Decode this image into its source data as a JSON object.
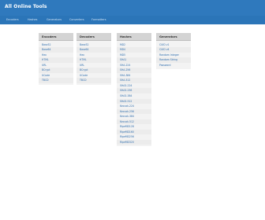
{
  "brand": "All Online Tools",
  "nav": [
    "Encoders",
    "Hashes",
    "Generators",
    "Converters",
    "Formatters"
  ],
  "columns": [
    {
      "title": "Encoders",
      "items": [
        "Base32",
        "Base64",
        "Hex",
        "HTML",
        "URL",
        "BCrypt",
        "UCode",
        "TBCD"
      ]
    },
    {
      "title": "Decoders",
      "items": [
        "Base32",
        "Base64",
        "Hex",
        "HTML",
        "URL",
        "BCrypt",
        "UCode",
        "TBCD"
      ]
    },
    {
      "title": "Hashes",
      "items": [
        "MD2",
        "MD4",
        "MD5",
        "SHA1",
        "SHA-224",
        "SHA-256",
        "SHA-384",
        "SHA-512",
        "SHA3-224",
        "SHA3-256",
        "SHA3-384",
        "SHA3-512",
        "Keccak-224",
        "Keccak-256",
        "Keccak-384",
        "Keccak-512",
        "RipeMD128",
        "RipeMD160",
        "RipeMD256",
        "RipeMD320"
      ]
    },
    {
      "title": "Generators",
      "items": [
        "CUID v1",
        "CUID v4",
        "Random Integer",
        "Random String",
        "Password"
      ]
    }
  ]
}
